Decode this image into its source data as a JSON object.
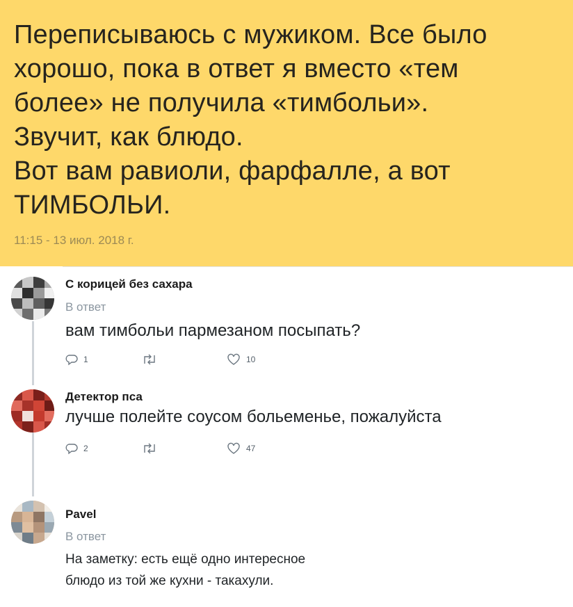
{
  "post": {
    "lines": [
      "Переписываюсь с мужиком. Все было",
      "хорошо, пока в ответ я вместо «тем",
      "более» не получила «тимбольи».",
      "Звучит, как блюдо.",
      "Вот вам равиоли, фарфалле, а вот",
      "ТИМБОЛЬИ."
    ],
    "timestamp": "11:15 - 13 июл. 2018 г."
  },
  "comments": [
    {
      "author": "С корицей без сахара",
      "reply_label": "В ответ",
      "text": "вам тимбольи пармезаном посыпать?",
      "replies": "1",
      "likes": "10"
    },
    {
      "author": "Детектор пса",
      "text": "лучше полейте соусом больеменье, пожалуйста",
      "replies": "2",
      "likes": "47"
    },
    {
      "author": "Pavel",
      "reply_label": "В ответ",
      "text_lines": [
        "На заметку: есть ещё одно интересное",
        "блюдо из той же кухни - такахули."
      ]
    }
  ],
  "colors": {
    "post_background": "#fed86a",
    "thread_line": "#cfd4d9",
    "secondary_text": "#8b96a0"
  },
  "icons": [
    "reply-icon",
    "retweet-icon",
    "like-icon"
  ]
}
